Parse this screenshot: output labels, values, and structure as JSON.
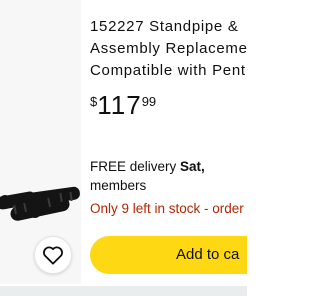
{
  "product": {
    "title_lines": [
      "152227 Standpipe &",
      "Assembly Replacemen",
      "Compatible with Pent"
    ],
    "price": {
      "symbol": "$",
      "whole": "117",
      "fraction": "99"
    },
    "delivery": {
      "prefix": "FREE delivery ",
      "date": "Sat,",
      "suffix": "members"
    },
    "stock": "Only 9 left in stock - order",
    "add_to_cart_label": "Add to ca"
  },
  "icons": {
    "wishlist": "heart-icon"
  },
  "colors": {
    "button": "#ffd814",
    "stock": "#b12704",
    "image_bg": "#f7f7f7"
  }
}
